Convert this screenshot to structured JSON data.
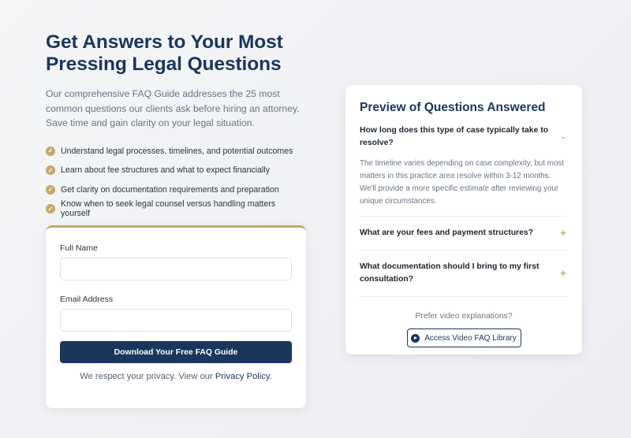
{
  "hero": {
    "headline": "Get Answers to Your Most Pressing Legal Questions",
    "intro": "Our comprehensive FAQ Guide addresses the 25 most common questions our clients ask before hiring an attorney. Save time and gain clarity on your legal situation.",
    "bullets": [
      "Understand legal processes, timelines, and potential outcomes",
      "Learn about fee structures and what to expect financially",
      "Get clarity on documentation requirements and preparation",
      "Know when to seek legal counsel versus handling matters yourself"
    ],
    "check_icon": "check-circle-icon"
  },
  "form": {
    "name_label": "Full Name",
    "name_value": "",
    "email_label": "Email Address",
    "email_value": "",
    "submit_label": "Download Your Free FAQ Guide",
    "privacy_text": "We respect your privacy. View our",
    "privacy_link": "Privacy Policy."
  },
  "faq": {
    "title": "Preview of Questions Answered",
    "items": [
      {
        "question": "How long does this type of case typically take to resolve?",
        "answer": "The timeline varies depending on case complexity, but most matters in this practice area resolve within 3-12 months. We'll provide a more specific estimate after reviewing your unique circumstances.",
        "toggle": "-",
        "expanded": true
      },
      {
        "question": "What are your fees and payment structures?",
        "toggle": "+",
        "expanded": false
      },
      {
        "question": "What documentation should I bring to my first consultation?",
        "toggle": "+",
        "expanded": false
      }
    ],
    "video_prompt": "Prefer video explanations?",
    "video_button": "Access Video FAQ Library",
    "video_icon": "play-circle-icon"
  },
  "colors": {
    "navy": "#1b365d",
    "gold": "#c9a66b",
    "background": "#f0f1f4"
  }
}
